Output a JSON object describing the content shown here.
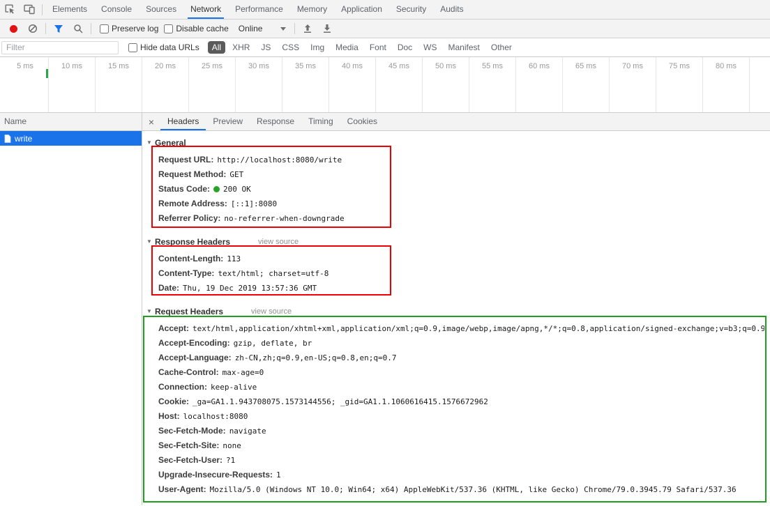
{
  "main_tabs": {
    "items": [
      "Elements",
      "Console",
      "Sources",
      "Network",
      "Performance",
      "Memory",
      "Application",
      "Security",
      "Audits"
    ],
    "selected": "Network"
  },
  "network_toolbar": {
    "preserve_log_label": "Preserve log",
    "disable_cache_label": "Disable cache",
    "throttling_value": "Online"
  },
  "filter_bar": {
    "filter_placeholder": "Filter",
    "hide_data_urls_label": "Hide data URLs",
    "pills": [
      "All",
      "XHR",
      "JS",
      "CSS",
      "Img",
      "Media",
      "Font",
      "Doc",
      "WS",
      "Manifest",
      "Other"
    ],
    "selected_pill": "All"
  },
  "timeline": {
    "ticks": [
      "5 ms",
      "10 ms",
      "15 ms",
      "20 ms",
      "25 ms",
      "30 ms",
      "35 ms",
      "40 ms",
      "45 ms",
      "50 ms",
      "55 ms",
      "60 ms",
      "65 ms",
      "70 ms",
      "75 ms",
      "80 ms"
    ]
  },
  "request_list": {
    "name_column_header": "Name",
    "rows": [
      {
        "name": "write",
        "selected": true
      }
    ]
  },
  "details_panel": {
    "close_label": "×",
    "tabs": [
      "Headers",
      "Preview",
      "Response",
      "Timing",
      "Cookies"
    ],
    "selected_tab": "Headers",
    "view_source_label": "view source",
    "general": {
      "title": "General",
      "items": [
        {
          "name": "Request URL:",
          "value": "http://localhost:8080/write"
        },
        {
          "name": "Request Method:",
          "value": "GET"
        },
        {
          "name": "Status Code:",
          "value": "200 OK",
          "status_icon": "green-dot"
        },
        {
          "name": "Remote Address:",
          "value": "[::1]:8080"
        },
        {
          "name": "Referrer Policy:",
          "value": "no-referrer-when-downgrade"
        }
      ]
    },
    "response_headers": {
      "title": "Response Headers",
      "items": [
        {
          "name": "Content-Length:",
          "value": "113"
        },
        {
          "name": "Content-Type:",
          "value": "text/html; charset=utf-8"
        },
        {
          "name": "Date:",
          "value": "Thu, 19 Dec 2019 13:57:36 GMT"
        }
      ]
    },
    "request_headers": {
      "title": "Request Headers",
      "items": [
        {
          "name": "Accept:",
          "value": "text/html,application/xhtml+xml,application/xml;q=0.9,image/webp,image/apng,*/*;q=0.8,application/signed-exchange;v=b3;q=0.9"
        },
        {
          "name": "Accept-Encoding:",
          "value": "gzip, deflate, br"
        },
        {
          "name": "Accept-Language:",
          "value": "zh-CN,zh;q=0.9,en-US;q=0.8,en;q=0.7"
        },
        {
          "name": "Cache-Control:",
          "value": "max-age=0"
        },
        {
          "name": "Connection:",
          "value": "keep-alive"
        },
        {
          "name": "Cookie:",
          "value": "_ga=GA1.1.943708075.1573144556; _gid=GA1.1.1060616415.1576672962"
        },
        {
          "name": "Host:",
          "value": "localhost:8080"
        },
        {
          "name": "Sec-Fetch-Mode:",
          "value": "navigate"
        },
        {
          "name": "Sec-Fetch-Site:",
          "value": "none"
        },
        {
          "name": "Sec-Fetch-User:",
          "value": "?1"
        },
        {
          "name": "Upgrade-Insecure-Requests:",
          "value": "1"
        },
        {
          "name": "User-Agent:",
          "value": "Mozilla/5.0 (Windows NT 10.0; Win64; x64) AppleWebKit/537.36 (KHTML, like Gecko) Chrome/79.0.3945.79 Safari/537.36"
        }
      ]
    }
  },
  "colors": {
    "accent_blue": "#1a73e8",
    "selected_row_blue": "#1a73e8",
    "status_dot_green": "#27a327",
    "record_red": "#e31212",
    "waterfall_green": "#2da44e",
    "selected_pill_bg": "#5b5b5b",
    "annotation_red": "#ee0000",
    "annotation_green": "#1ea01e"
  }
}
